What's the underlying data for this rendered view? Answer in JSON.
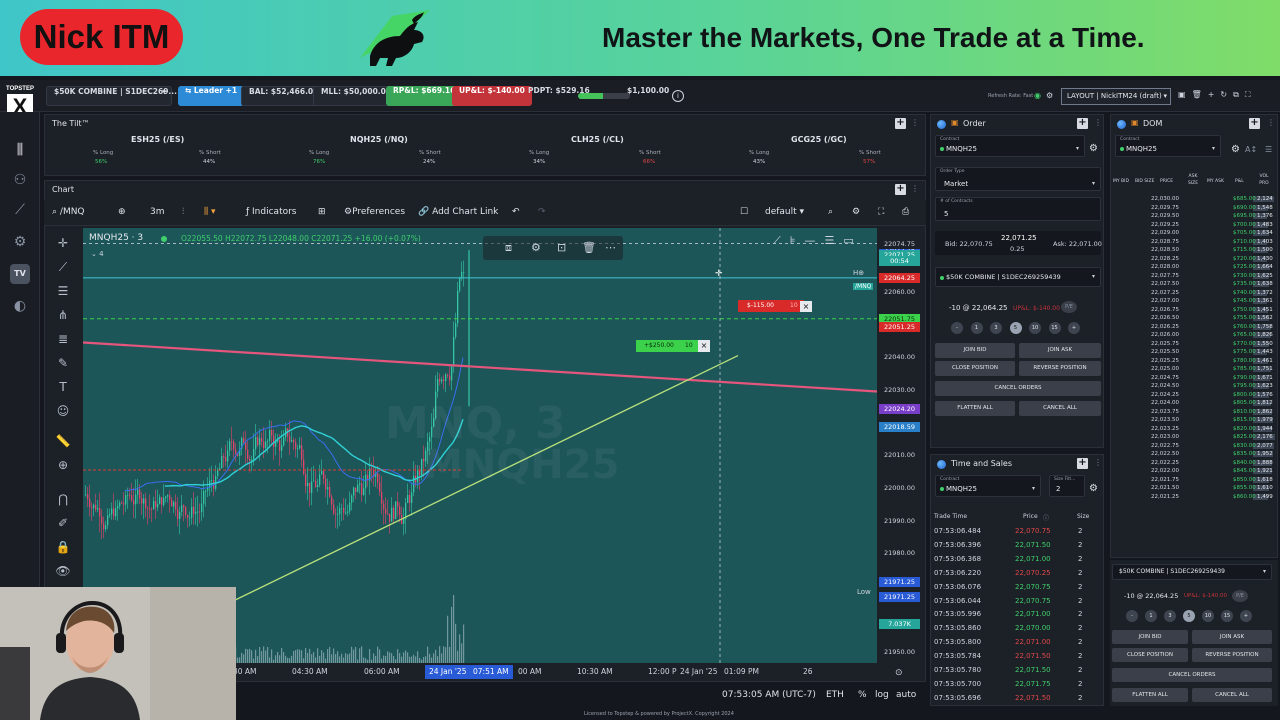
{
  "banner": {
    "brand": "Nick ITM",
    "tagline": "Master the Markets, One Trade at a Time."
  },
  "topbar": {
    "logo_text": "TOPSTEP",
    "logo_mark": "X",
    "account": "$50K COMBINE | S1DEC269...",
    "leader": "Leader +1",
    "bal": "BAL: $52,466.00",
    "mll": "MLL: $50,000.00",
    "rpl": "RP&L: $669.16",
    "upl": "UP&L: $-140.00",
    "pdpt": "PDPT: $529.16",
    "pdpt_progress": 0.48,
    "pdpt_target": "$1,100.00",
    "refresh_rate": "Refresh Rate: Fast",
    "layout": "LAYOUT | NickITM24 (draft)"
  },
  "tilt": {
    "title": "The Tilt™",
    "columns": [
      {
        "name": "ESH25 (/ES)",
        "long_label": "% Long",
        "long": "56%",
        "short_label": "% Short",
        "short": "44%"
      },
      {
        "name": "NQH25 (/NQ)",
        "long_label": "% Long",
        "long": "76%",
        "short_label": "% Short",
        "short": "24%"
      },
      {
        "name": "CLH25 (/CL)",
        "long_label": "% Long",
        "long": "34%",
        "short_label": "% Short",
        "short": "66%"
      },
      {
        "name": "GCG25 (/GC)",
        "long_label": "% Long",
        "long": "43%",
        "short_label": "% Short",
        "short": "57%"
      }
    ]
  },
  "chart": {
    "title": "Chart",
    "symbol": "/MNQ",
    "interval": "3m",
    "indicators": "Indicators",
    "preferences": "Preferences",
    "add_chart_link": "Add Chart Link",
    "template": "default",
    "ohlc_symbol": "MNQH25 · 3",
    "ohlc": "O22055.50  H22072.75  L22048.00  C22071.25  +16.00 (+0.07%)",
    "sub_count": "4",
    "watermark_top": "MNQ, 3",
    "watermark_bottom": "MNQH25",
    "pnl_flag_red": "$-115.00",
    "pnl_flag_green": "+$250.00",
    "pnl_flag_green_qty": "10",
    "pnl_flag_red_qty": "10",
    "low_label": "Low",
    "price_labels": [
      {
        "text": "22072.75",
        "y": 22072.75,
        "bg": "#2a5bd7",
        "fg": "#ffffff"
      },
      {
        "text": "22074.75",
        "y": 22074.75,
        "bg": "#1c2027",
        "fg": "#cfd5df"
      },
      {
        "text": "22071.25",
        "y": 22071.25,
        "bg": "#26a69a",
        "fg": "#ffffff"
      },
      {
        "text": "00:54",
        "y": 22069.4,
        "bg": "#26a69a",
        "fg": "#ffffff"
      },
      {
        "text": "22064.25",
        "y": 22064.25,
        "bg": "#d92a2a",
        "fg": "#ffffff"
      },
      {
        "text": "22060.00",
        "y": 22060.0,
        "bg": "#1c2027",
        "fg": "#cfd5df"
      },
      {
        "text": "22051.75",
        "y": 22051.75,
        "bg": "#3bd14a",
        "fg": "#0b2b10"
      },
      {
        "text": "22051.25",
        "y": 22049.3,
        "bg": "#d92a2a",
        "fg": "#ffffff"
      },
      {
        "text": "22040.00",
        "y": 22040.0,
        "bg": "#1c2027",
        "fg": "#cfd5df"
      },
      {
        "text": "22030.00",
        "y": 22030.0,
        "bg": "#1c2027",
        "fg": "#cfd5df"
      },
      {
        "text": "22024.20",
        "y": 22024.2,
        "bg": "#7a3fc8",
        "fg": "#ffffff"
      },
      {
        "text": "22018.59",
        "y": 22018.59,
        "bg": "#2a80c8",
        "fg": "#ffffff"
      },
      {
        "text": "22010.00",
        "y": 22010.0,
        "bg": "#1c2027",
        "fg": "#cfd5df"
      },
      {
        "text": "22000.00",
        "y": 22000.0,
        "bg": "#1c2027",
        "fg": "#cfd5df"
      },
      {
        "text": "21990.00",
        "y": 21990.0,
        "bg": "#1c2027",
        "fg": "#cfd5df"
      },
      {
        "text": "21980.00",
        "y": 21980.0,
        "bg": "#1c2027",
        "fg": "#cfd5df"
      },
      {
        "text": "21971.25",
        "y": 21971.25,
        "bg": "#2a5bd7",
        "fg": "#ffffff"
      },
      {
        "text": "21971.25",
        "y": 21966.6,
        "bg": "#2a5bd7",
        "fg": "#ffffff"
      },
      {
        "text": "7.037K",
        "y": 21958.5,
        "bg": "#26a69a",
        "fg": "#ffffff"
      },
      {
        "text": "21950.00",
        "y": 21950.0,
        "bg": "#1c2027",
        "fg": "#cfd5df"
      }
    ],
    "time_labels": [
      "30 AM",
      "04:30 AM",
      "06:00 AM",
      "24 Jan '25",
      "07:51 AM",
      "00 AM",
      "10:30 AM",
      "12:00 P",
      "24 Jan '25",
      "01:09 PM",
      "26"
    ],
    "status_clock": "07:53:05 AM (UTC-7)",
    "status_session": "ETH",
    "status_pct": "%",
    "status_log": "log",
    "status_auto": "auto",
    "legal": "Licensed to Topstep & powered by ProjectX. Copyright 2024"
  },
  "order": {
    "title": "Order",
    "contract_label": "Contract",
    "contract": "MNQH25",
    "order_type_label": "Order Type",
    "order_type": "Market",
    "contracts_label": "# of Contracts",
    "contracts": "5",
    "bid": "Bid: 22,070.75",
    "last": "22,071.25",
    "spread": "0.25",
    "ask": "Ask: 22,071.00",
    "account": "$50K COMBINE | S1DEC269259439",
    "position": "-10 @ 22,064.25",
    "position_pnl": "UP&L: $-140.00",
    "pe": "P/E",
    "qty_buttons": [
      "-",
      "1",
      "3",
      "5",
      "10",
      "15",
      "+"
    ],
    "qty_selected": "5",
    "buttons": [
      "JOIN BID",
      "JOIN ASK",
      "CLOSE POSITION",
      "REVERSE POSITION",
      "CANCEL ORDERS",
      "FLATTEN ALL",
      "CANCEL ALL"
    ]
  },
  "ts": {
    "title": "Time and Sales",
    "contract_label": "Contract",
    "contract": "MNQH25",
    "size_label": "Size Filt...",
    "size": "2",
    "headers": [
      "Trade Time",
      "Price",
      "Size"
    ],
    "rows": [
      {
        "time": "07:53:06.484",
        "price": "22,070.75",
        "size": "2",
        "side": "sell"
      },
      {
        "time": "07:53:06.396",
        "price": "22,071.50",
        "size": "2",
        "side": "buy"
      },
      {
        "time": "07:53:06.368",
        "price": "22,071.00",
        "size": "2",
        "side": "buy"
      },
      {
        "time": "07:53:06.220",
        "price": "22,070.25",
        "size": "2",
        "side": "sell"
      },
      {
        "time": "07:53:06.076",
        "price": "22,070.75",
        "size": "2",
        "side": "buy"
      },
      {
        "time": "07:53:06.044",
        "price": "22,070.75",
        "size": "2",
        "side": "buy"
      },
      {
        "time": "07:53:05.996",
        "price": "22,071.00",
        "size": "2",
        "side": "buy"
      },
      {
        "time": "07:53:05.860",
        "price": "22,070.00",
        "size": "2",
        "side": "buy"
      },
      {
        "time": "07:53:05.800",
        "price": "22,071.00",
        "size": "2",
        "side": "sell"
      },
      {
        "time": "07:53:05.784",
        "price": "22,071.50",
        "size": "2",
        "side": "sell"
      },
      {
        "time": "07:53:05.780",
        "price": "22,071.50",
        "size": "2",
        "side": "buy"
      },
      {
        "time": "07:53:05.700",
        "price": "22,071.75",
        "size": "2",
        "side": "buy"
      },
      {
        "time": "07:53:05.696",
        "price": "22,071.50",
        "size": "2",
        "side": "sell"
      }
    ]
  },
  "dom": {
    "title": "DOM",
    "contract_label": "Contract",
    "contract": "MNQH25",
    "headers": [
      "MY BID",
      "BID SIZE",
      "PRICE",
      "ASK SIZE",
      "MY ASK",
      "P&L",
      "VOL PRO"
    ],
    "rows": [
      {
        "price": "22,030.00",
        "pnl": "$685.00",
        "vol": "2,124"
      },
      {
        "price": "22,029.75",
        "pnl": "$690.00",
        "vol": "1,548"
      },
      {
        "price": "22,029.50",
        "pnl": "$695.00",
        "vol": "1,376"
      },
      {
        "price": "22,029.25",
        "pnl": "$700.00",
        "vol": "1,483"
      },
      {
        "price": "22,029.00",
        "pnl": "$705.00",
        "vol": "1,634"
      },
      {
        "price": "22,028.75",
        "pnl": "$710.00",
        "vol": "1,403"
      },
      {
        "price": "22,028.50",
        "pnl": "$715.00",
        "vol": "1,500"
      },
      {
        "price": "22,028.25",
        "pnl": "$720.00",
        "vol": "1,430"
      },
      {
        "price": "22,028.00",
        "pnl": "$725.00",
        "vol": "1,664"
      },
      {
        "price": "22,027.75",
        "pnl": "$730.00",
        "vol": "1,625"
      },
      {
        "price": "22,027.50",
        "pnl": "$735.00",
        "vol": "1,638"
      },
      {
        "price": "22,027.25",
        "pnl": "$740.00",
        "vol": "1,372"
      },
      {
        "price": "22,027.00",
        "pnl": "$745.00",
        "vol": "1,361"
      },
      {
        "price": "22,026.75",
        "pnl": "$750.00",
        "vol": "1,451"
      },
      {
        "price": "22,026.50",
        "pnl": "$755.00",
        "vol": "1,562"
      },
      {
        "price": "22,026.25",
        "pnl": "$760.00",
        "vol": "1,758"
      },
      {
        "price": "22,026.00",
        "pnl": "$765.00",
        "vol": "1,826"
      },
      {
        "price": "22,025.75",
        "pnl": "$770.00",
        "vol": "1,550"
      },
      {
        "price": "22,025.50",
        "pnl": "$775.00",
        "vol": "1,443"
      },
      {
        "price": "22,025.25",
        "pnl": "$780.00",
        "vol": "1,461"
      },
      {
        "price": "22,025.00",
        "pnl": "$785.00",
        "vol": "1,751"
      },
      {
        "price": "22,024.75",
        "pnl": "$790.00",
        "vol": "1,671"
      },
      {
        "price": "22,024.50",
        "pnl": "$795.00",
        "vol": "1,623"
      },
      {
        "price": "22,024.25",
        "pnl": "$800.00",
        "vol": "1,576"
      },
      {
        "price": "22,024.00",
        "pnl": "$805.00",
        "vol": "1,812"
      },
      {
        "price": "22,023.75",
        "pnl": "$810.00",
        "vol": "1,862"
      },
      {
        "price": "22,023.50",
        "pnl": "$815.00",
        "vol": "1,979"
      },
      {
        "price": "22,023.25",
        "pnl": "$820.00",
        "vol": "1,944"
      },
      {
        "price": "22,023.00",
        "pnl": "$825.00",
        "vol": "2,176"
      },
      {
        "price": "22,022.75",
        "pnl": "$830.00",
        "vol": "2,077"
      },
      {
        "price": "22,022.50",
        "pnl": "$835.00",
        "vol": "1,952"
      },
      {
        "price": "22,022.25",
        "pnl": "$840.00",
        "vol": "1,888"
      },
      {
        "price": "22,022.00",
        "pnl": "$845.00",
        "vol": "1,921"
      },
      {
        "price": "22,021.75",
        "pnl": "$850.00",
        "vol": "1,618"
      },
      {
        "price": "22,021.50",
        "pnl": "$855.00",
        "vol": "1,610"
      },
      {
        "price": "22,021.25",
        "pnl": "$860.00",
        "vol": "1,499"
      }
    ],
    "account": "$50K COMBINE | S1DEC269259439",
    "position": "-10 @ 22,064.25",
    "position_pnl": "UP&L: $-140.00",
    "pe": "P/E",
    "qty_buttons": [
      "-",
      "1",
      "3",
      "5",
      "10",
      "15",
      "+"
    ],
    "qty_selected": "5",
    "buttons": [
      "JOIN BID",
      "JOIN ASK",
      "CLOSE POSITION",
      "REVERSE POSITION",
      "CANCEL ORDERS",
      "FLATTEN ALL",
      "CANCEL ALL"
    ]
  },
  "colors": {
    "accent_blue": "#2d8ad6",
    "profit_green": "#3aa657",
    "loss_red": "#c2343a",
    "buy_text": "#3fcf6b",
    "sell_text": "#e04848",
    "chart_bg": "#1c5659"
  }
}
